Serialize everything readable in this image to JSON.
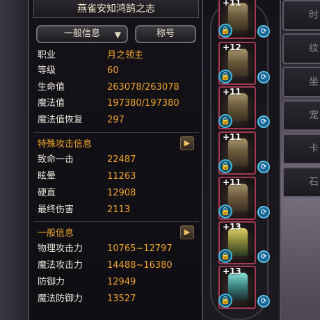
{
  "window": {
    "title": "燕雀安知鸿鹄之志"
  },
  "tabs": {
    "general": "一般信息",
    "titles": "称号"
  },
  "basic_stats": [
    {
      "label": "职业",
      "value": "月之领主"
    },
    {
      "label": "等级",
      "value": "60"
    },
    {
      "label": "生命值",
      "value": "263078/263078"
    },
    {
      "label": "魔法值",
      "value": "197380/197380"
    },
    {
      "label": "魔法值恢复",
      "value": "297"
    }
  ],
  "special_attack": {
    "title": "特殊攻击信息",
    "stats": [
      {
        "label": "致命一击",
        "value": "22487"
      },
      {
        "label": "眩晕",
        "value": "11263"
      },
      {
        "label": "硬直",
        "value": "12908"
      },
      {
        "label": "最终伤害",
        "value": "2113"
      }
    ]
  },
  "general_info": {
    "title": "一般信息",
    "stats": [
      {
        "label": "物理攻击力",
        "value": "10765~12797"
      },
      {
        "label": "魔法攻击力",
        "value": "14488~16380"
      },
      {
        "label": "防御力",
        "value": "12949"
      },
      {
        "label": "魔法防御力",
        "value": "13527"
      }
    ]
  },
  "equipment": [
    {
      "plus": "+11",
      "art": "armor"
    },
    {
      "plus": "+12",
      "art": "armor"
    },
    {
      "plus": "+11",
      "art": "armor"
    },
    {
      "plus": "+11",
      "art": "armor"
    },
    {
      "plus": "+11",
      "art": "armor"
    },
    {
      "plus": "+13",
      "art": "weapon-green"
    },
    {
      "plus": "+13",
      "art": "weapon-teal"
    }
  ],
  "right_tabs": [
    "时",
    "纹",
    "坐",
    "宠",
    "卡",
    "石"
  ],
  "icons": {
    "lock": "lock-icon",
    "swap": "swap-icon",
    "arrow": "chevron-right-icon",
    "dropdown": "chevron-down-icon"
  },
  "colors": {
    "label": "#e8e4da",
    "value": "#f0a62c",
    "slot_border": "#a43a52",
    "lock_ring": "#43b7dc"
  }
}
